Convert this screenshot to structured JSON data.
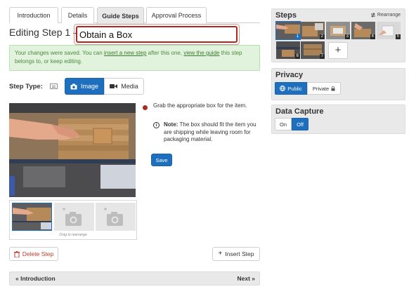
{
  "tabs": [
    {
      "label": "Introduction",
      "active": false
    },
    {
      "label": "Details",
      "active": false
    },
    {
      "label": "Guide Steps",
      "active": true
    },
    {
      "label": "Approval Process",
      "active": false
    }
  ],
  "editor": {
    "heading": "Editing Step 1 —",
    "title_value": "Obtain a Box"
  },
  "alert": {
    "text_before": "Your changes were saved. You can ",
    "link1": "insert a new step",
    "text_middle": " after this one, ",
    "link2": "view the guide",
    "text_after": " this step belongs to, or keep editing."
  },
  "step_type": {
    "label": "Step Type:",
    "image_label": "Image",
    "media_label": "Media",
    "selected": "Image"
  },
  "media": {
    "drag_hint": "Drag to rearrange"
  },
  "content": {
    "bullet_text": "Grab the appropriate box for the item.",
    "note_label": "Note:",
    "note_text": " The box should fit the item you are shipping while leaving room for packaging material.",
    "save_label": "Save"
  },
  "actions": {
    "delete_label": "Delete Step",
    "insert_label": "Insert Step"
  },
  "navigation": {
    "prev_label": "« Introduction",
    "next_label": "Next »"
  },
  "steps_panel": {
    "title": "Steps",
    "rearrange_label": "Rearrange",
    "steps": [
      {
        "number": "1",
        "active": true
      },
      {
        "number": "2",
        "active": false
      },
      {
        "number": "3",
        "active": false
      },
      {
        "number": "4",
        "active": false
      },
      {
        "number": "5",
        "active": false
      },
      {
        "number": "6",
        "active": false
      },
      {
        "number": "7",
        "active": false
      }
    ],
    "add_label": "+"
  },
  "privacy": {
    "title": "Privacy",
    "public_label": "Public",
    "private_label": "Private",
    "selected": "Public"
  },
  "data_capture": {
    "title": "Data Capture",
    "on_label": "On",
    "off_label": "Off",
    "selected": "Off"
  },
  "colors": {
    "accent": "#1f6fbf",
    "title_border": "#b0281c",
    "alert_bg": "#e2f3dd",
    "alert_text": "#4a8a3c",
    "danger": "#c0392b"
  }
}
